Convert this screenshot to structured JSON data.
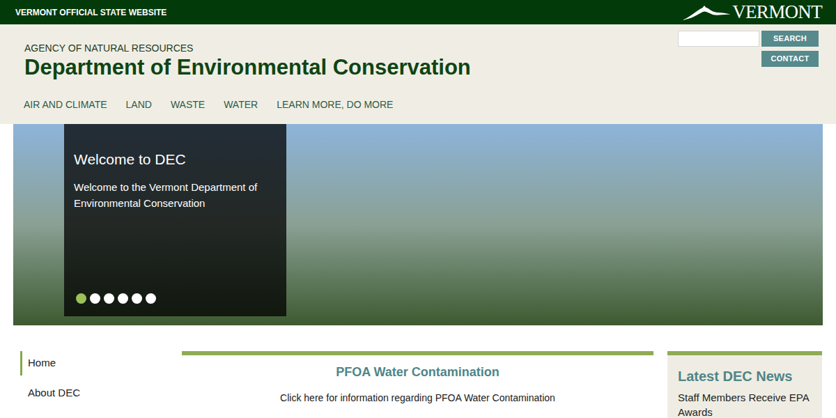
{
  "top_bar": {
    "title": "VERMONT OFFICIAL STATE WEBSITE",
    "logo": "VERMONT"
  },
  "header": {
    "agency": "AGENCY OF NATURAL RESOURCES",
    "department": "Department of Environmental Conservation"
  },
  "search": {
    "button": "SEARCH"
  },
  "contact": "CONTACT",
  "nav": [
    "AIR AND CLIMATE",
    "LAND",
    "WASTE",
    "WATER",
    "LEARN MORE, DO MORE"
  ],
  "hero": {
    "title": "Welcome to DEC",
    "text": "Welcome to the Vermont Department of Environmental Conservation",
    "slides": [
      {
        "selected": true
      },
      {
        "selected": false
      },
      {
        "selected": false
      },
      {
        "selected": false
      },
      {
        "selected": false
      },
      {
        "selected": false
      }
    ]
  },
  "sidebar": [
    {
      "label": "Home",
      "selected": true
    },
    {
      "label": "About DEC",
      "selected": false
    }
  ],
  "feature": {
    "title": "PFOA Water Contamination",
    "link": "Click here for information regarding PFOA Water Contamination"
  },
  "news": {
    "title": "Latest DEC News",
    "items": [
      "Staff Members Receive EPA Awards"
    ]
  }
}
